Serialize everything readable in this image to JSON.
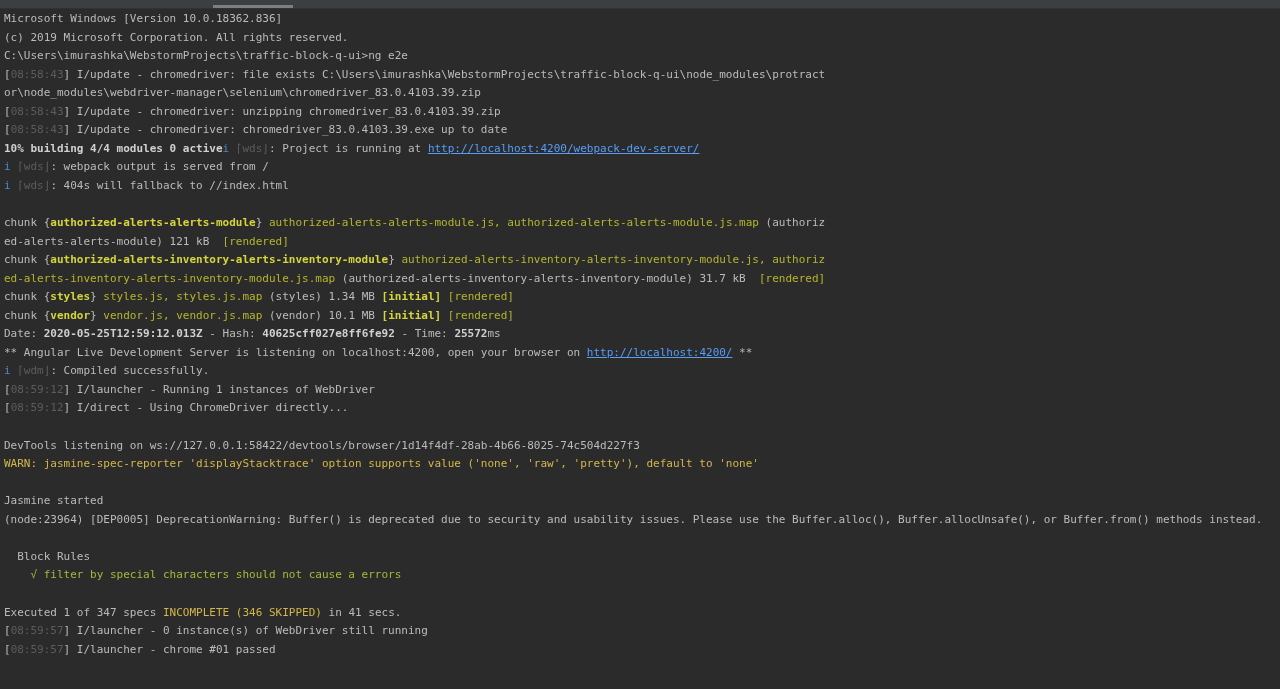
{
  "terminal": {
    "lines": [
      {
        "kind": "text",
        "segments": [
          {
            "kind": "plain",
            "text": "Microsoft Windows [Version 10.0.18362.836]"
          }
        ]
      },
      {
        "kind": "text",
        "segments": [
          {
            "kind": "plain",
            "text": "(c) 2019 Microsoft Corporation. All rights reserved."
          }
        ]
      },
      {
        "kind": "text",
        "segments": [
          {
            "kind": "plain",
            "text": "C:\\Users\\imurashka\\WebstormProjects\\traffic-block-q-ui>ng e2e"
          }
        ]
      },
      {
        "kind": "text",
        "segments": [
          {
            "kind": "plain",
            "text": "["
          },
          {
            "kind": "dim",
            "text": "08:58:43"
          },
          {
            "kind": "plain",
            "text": "] I/update - chromedriver: file exists C:\\Users\\imurashka\\WebstormProjects\\traffic-block-q-ui\\node_modules\\protract"
          }
        ]
      },
      {
        "kind": "text",
        "segments": [
          {
            "kind": "plain",
            "text": "or\\node_modules\\webdriver-manager\\selenium\\chromedriver_83.0.4103.39.zip"
          }
        ]
      },
      {
        "kind": "text",
        "segments": [
          {
            "kind": "plain",
            "text": "["
          },
          {
            "kind": "dim",
            "text": "08:58:43"
          },
          {
            "kind": "plain",
            "text": "] I/update - chromedriver: unzipping chromedriver_83.0.4103.39.zip"
          }
        ]
      },
      {
        "kind": "text",
        "segments": [
          {
            "kind": "plain",
            "text": "["
          },
          {
            "kind": "dim",
            "text": "08:58:43"
          },
          {
            "kind": "plain",
            "text": "] I/update - chromedriver: chromedriver_83.0.4103.39.exe up to date"
          }
        ]
      },
      {
        "kind": "text",
        "segments": [
          {
            "kind": "bold",
            "text": "10% building 4/4 modules 0 active"
          },
          {
            "kind": "info",
            "text": "i"
          },
          {
            "kind": "dim",
            "text": " ⌈wds⌋"
          },
          {
            "kind": "plain",
            "text": ": Project is running at "
          },
          {
            "kind": "link",
            "text": "http://localhost:4200/webpack-dev-server/"
          }
        ]
      },
      {
        "kind": "text",
        "segments": [
          {
            "kind": "info",
            "text": "i"
          },
          {
            "kind": "dim",
            "text": " ⌈wds⌋"
          },
          {
            "kind": "plain",
            "text": ": webpack output is served from /"
          }
        ]
      },
      {
        "kind": "text",
        "segments": [
          {
            "kind": "info",
            "text": "i"
          },
          {
            "kind": "dim",
            "text": " ⌈wds⌋"
          },
          {
            "kind": "plain",
            "text": ": 404s will fallback to //index.html"
          }
        ]
      },
      {
        "kind": "blank"
      },
      {
        "kind": "text",
        "segments": [
          {
            "kind": "plain",
            "text": "chunk {"
          },
          {
            "kind": "yellow-bold",
            "text": "authorized-alerts-alerts-module"
          },
          {
            "kind": "plain",
            "text": "} "
          },
          {
            "kind": "yellow",
            "text": "authorized-alerts-alerts-module.js, authorized-alerts-alerts-module.js.map"
          },
          {
            "kind": "plain",
            "text": " (authoriz"
          }
        ]
      },
      {
        "kind": "text",
        "segments": [
          {
            "kind": "plain",
            "text": "ed-alerts-alerts-module) 121 kB  "
          },
          {
            "kind": "yellow",
            "text": "[rendered]"
          }
        ]
      },
      {
        "kind": "text",
        "segments": [
          {
            "kind": "plain",
            "text": "chunk {"
          },
          {
            "kind": "yellow-bold",
            "text": "authorized-alerts-inventory-alerts-inventory-module"
          },
          {
            "kind": "plain",
            "text": "} "
          },
          {
            "kind": "yellow",
            "text": "authorized-alerts-inventory-alerts-inventory-module.js, authoriz"
          }
        ]
      },
      {
        "kind": "text",
        "segments": [
          {
            "kind": "yellow",
            "text": "ed-alerts-inventory-alerts-inventory-module.js.map"
          },
          {
            "kind": "plain",
            "text": " (authorized-alerts-inventory-alerts-inventory-module) 31.7 kB  "
          },
          {
            "kind": "yellow",
            "text": "[rendered]"
          }
        ]
      },
      {
        "kind": "text",
        "segments": [
          {
            "kind": "plain",
            "text": "chunk {"
          },
          {
            "kind": "yellow-bold",
            "text": "styles"
          },
          {
            "kind": "plain",
            "text": "} "
          },
          {
            "kind": "yellow",
            "text": "styles.js, styles.js.map"
          },
          {
            "kind": "plain",
            "text": " (styles) 1.34 MB "
          },
          {
            "kind": "yellow-bold",
            "text": "[initial]"
          },
          {
            "kind": "yellow",
            "text": " [rendered]"
          }
        ]
      },
      {
        "kind": "text",
        "segments": [
          {
            "kind": "plain",
            "text": "chunk {"
          },
          {
            "kind": "yellow-bold",
            "text": "vendor"
          },
          {
            "kind": "plain",
            "text": "} "
          },
          {
            "kind": "yellow",
            "text": "vendor.js, vendor.js.map"
          },
          {
            "kind": "plain",
            "text": " (vendor) 10.1 MB "
          },
          {
            "kind": "yellow-bold",
            "text": "[initial]"
          },
          {
            "kind": "yellow",
            "text": " [rendered]"
          }
        ]
      },
      {
        "kind": "text",
        "segments": [
          {
            "kind": "plain",
            "text": "Date: "
          },
          {
            "kind": "bold",
            "text": "2020-05-25T12:59:12.013Z"
          },
          {
            "kind": "plain",
            "text": " - Hash: "
          },
          {
            "kind": "bold",
            "text": "40625cff027e8ff6fe92"
          },
          {
            "kind": "plain",
            "text": " - Time: "
          },
          {
            "kind": "bold",
            "text": "25572"
          },
          {
            "kind": "plain",
            "text": "ms"
          }
        ]
      },
      {
        "kind": "text",
        "segments": [
          {
            "kind": "plain",
            "text": "** Angular Live Development Server is listening on localhost:4200, open your browser on "
          },
          {
            "kind": "link",
            "text": "http://localhost:4200/"
          },
          {
            "kind": "plain",
            "text": " **"
          }
        ]
      },
      {
        "kind": "text",
        "segments": [
          {
            "kind": "info",
            "text": "i"
          },
          {
            "kind": "dim",
            "text": " ⌈wdm⌋"
          },
          {
            "kind": "plain",
            "text": ": Compiled successfully."
          }
        ]
      },
      {
        "kind": "text",
        "segments": [
          {
            "kind": "plain",
            "text": "["
          },
          {
            "kind": "dim",
            "text": "08:59:12"
          },
          {
            "kind": "plain",
            "text": "] I/launcher - Running 1 instances of WebDriver"
          }
        ]
      },
      {
        "kind": "text",
        "segments": [
          {
            "kind": "plain",
            "text": "["
          },
          {
            "kind": "dim",
            "text": "08:59:12"
          },
          {
            "kind": "plain",
            "text": "] I/direct - Using ChromeDriver directly..."
          }
        ]
      },
      {
        "kind": "blank"
      },
      {
        "kind": "text",
        "segments": [
          {
            "kind": "plain",
            "text": "DevTools listening on ws://127.0.0.1:58422/devtools/browser/1d14f4df-28ab-4b66-8025-74c504d227f3"
          }
        ]
      },
      {
        "kind": "text",
        "segments": [
          {
            "kind": "warn",
            "text": "WARN: jasmine-spec-reporter 'displayStacktrace' option supports value ('none', 'raw', 'pretty'), default to 'none'"
          }
        ]
      },
      {
        "kind": "blank"
      },
      {
        "kind": "text",
        "segments": [
          {
            "kind": "plain",
            "text": "Jasmine started"
          }
        ]
      },
      {
        "kind": "text",
        "segments": [
          {
            "kind": "plain",
            "text": "(node:23964) [DEP0005] DeprecationWarning: Buffer() is deprecated due to security and usability issues. Please use the Buffer.alloc(), Buffer.allocUnsafe(), or Buffer.from() methods instead."
          }
        ]
      },
      {
        "kind": "blank"
      },
      {
        "kind": "text",
        "segments": [
          {
            "kind": "plain",
            "text": "  Block Rules"
          }
        ]
      },
      {
        "kind": "text",
        "segments": [
          {
            "kind": "pass",
            "text": "    √ filter by special characters should not cause a errors"
          }
        ]
      },
      {
        "kind": "blank"
      },
      {
        "kind": "text",
        "segments": [
          {
            "kind": "plain",
            "text": "Executed 1 of 347 specs "
          },
          {
            "kind": "warn",
            "text": "INCOMPLETE (346 SKIPPED)"
          },
          {
            "kind": "plain",
            "text": " in 41 secs."
          }
        ]
      },
      {
        "kind": "text",
        "segments": [
          {
            "kind": "plain",
            "text": "["
          },
          {
            "kind": "dim",
            "text": "08:59:57"
          },
          {
            "kind": "plain",
            "text": "] I/launcher - 0 instance(s) of WebDriver still running"
          }
        ]
      },
      {
        "kind": "text",
        "segments": [
          {
            "kind": "plain",
            "text": "["
          },
          {
            "kind": "dim",
            "text": "08:59:57"
          },
          {
            "kind": "plain",
            "text": "] I/launcher - chrome #01 passed"
          }
        ]
      }
    ]
  }
}
